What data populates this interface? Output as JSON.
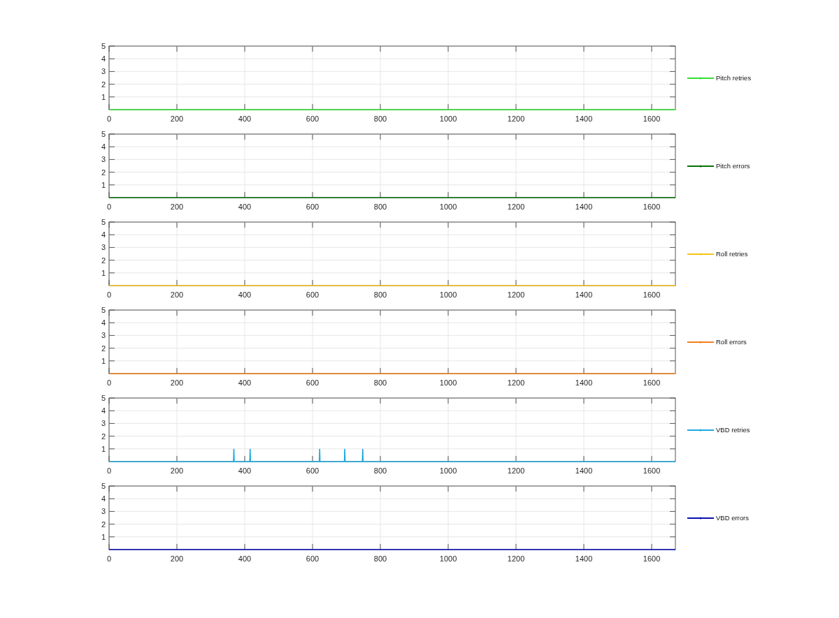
{
  "plots": [
    {
      "chart_data": {
        "type": "line",
        "grid": true,
        "x": [
          0,
          1670
        ],
        "series": [
          {
            "name": "Pitch retries",
            "color": "#33e033",
            "values": [
              0,
              0
            ]
          }
        ],
        "xlim": [
          0,
          1670
        ],
        "ylim": [
          0,
          5
        ],
        "xticks": [
          0,
          200,
          400,
          600,
          800,
          1000,
          1200,
          1400,
          1600
        ],
        "yticks": [
          1,
          2,
          3,
          4,
          5
        ]
      }
    },
    {
      "chart_data": {
        "type": "line",
        "grid": true,
        "x": [
          0,
          1670
        ],
        "series": [
          {
            "name": "Pitch errors",
            "color": "#0a700a",
            "values": [
              0,
              0
            ]
          }
        ],
        "xlim": [
          0,
          1670
        ],
        "ylim": [
          0,
          5
        ],
        "xticks": [
          0,
          200,
          400,
          600,
          800,
          1000,
          1200,
          1400,
          1600
        ],
        "yticks": [
          1,
          2,
          3,
          4,
          5
        ]
      }
    },
    {
      "chart_data": {
        "type": "line",
        "grid": true,
        "x": [
          0,
          1670
        ],
        "series": [
          {
            "name": "Roll retries",
            "color": "#f5c518",
            "values": [
              0,
              0
            ]
          }
        ],
        "xlim": [
          0,
          1670
        ],
        "ylim": [
          0,
          5
        ],
        "xticks": [
          0,
          200,
          400,
          600,
          800,
          1000,
          1200,
          1400,
          1600
        ],
        "yticks": [
          1,
          2,
          3,
          4,
          5
        ]
      }
    },
    {
      "chart_data": {
        "type": "line",
        "grid": true,
        "x": [
          0,
          1670
        ],
        "series": [
          {
            "name": "Roll errors",
            "color": "#f08020",
            "values": [
              0,
              0
            ]
          }
        ],
        "xlim": [
          0,
          1670
        ],
        "ylim": [
          0,
          5
        ],
        "xticks": [
          0,
          200,
          400,
          600,
          800,
          1000,
          1200,
          1400,
          1600
        ],
        "yticks": [
          1,
          2,
          3,
          4,
          5
        ]
      }
    },
    {
      "chart_data": {
        "type": "line",
        "grid": true,
        "x": [
          0,
          367,
          368,
          369,
          415,
          416,
          417,
          620,
          621,
          622,
          694,
          695,
          696,
          747,
          748,
          749,
          1670
        ],
        "series": [
          {
            "name": "VBD retries",
            "color": "#1fa8e0",
            "values": [
              0,
              0,
              1,
              0,
              0,
              1,
              0,
              0,
              1,
              0,
              0,
              1,
              0,
              0,
              1,
              0,
              0
            ]
          }
        ],
        "xlim": [
          0,
          1670
        ],
        "ylim": [
          0,
          5
        ],
        "xticks": [
          0,
          200,
          400,
          600,
          800,
          1000,
          1200,
          1400,
          1600
        ],
        "yticks": [
          1,
          2,
          3,
          4,
          5
        ]
      }
    },
    {
      "chart_data": {
        "type": "line",
        "grid": true,
        "x": [
          0,
          1670
        ],
        "series": [
          {
            "name": "VBD errors",
            "color": "#0a10b0",
            "values": [
              0,
              0
            ]
          }
        ],
        "xlim": [
          0,
          1670
        ],
        "ylim": [
          0,
          5
        ],
        "xticks": [
          0,
          200,
          400,
          600,
          800,
          1000,
          1200,
          1400,
          1600
        ],
        "yticks": [
          1,
          2,
          3,
          4,
          5
        ]
      }
    }
  ]
}
